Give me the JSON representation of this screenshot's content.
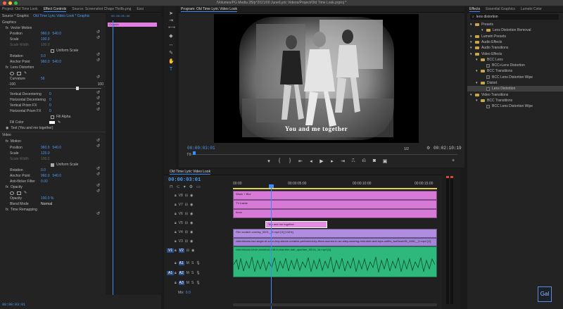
{
  "window": {
    "title": "/Volumes/PG Media 2B/p*2021/00 June/Lyric Videos/Project/Old Time Look.prproj *"
  },
  "effect_controls": {
    "tabs": [
      "Project: Old Time Look",
      "Effect Controls",
      "Source: Screenshot Chaps Thrills.png",
      "Essi"
    ],
    "source": "Source * Graphic",
    "sequence": "Old Time Lyric Video Look * Graphic",
    "timecode_top": "00:00:05:00",
    "clip_label": "Graphic",
    "section_graphics": "Graphics",
    "vector_motion": "Vector Motion",
    "position_label": "Position",
    "position_x": "960.0",
    "position_y": "540.0",
    "scale_label": "Scale",
    "scale_val": "100.0",
    "scale_width_label": "Scale Width",
    "scale_width_val": "100.0",
    "uniform_scale": "Uniform Scale",
    "rotation_label": "Rotation",
    "rotation_val": "0.0",
    "anchor_label": "Anchor Point",
    "anchor_x": "960.0",
    "anchor_y": "540.0",
    "lens_distortion": "Lens Distortion",
    "curvature_label": "Curvature",
    "curvature_val": "56",
    "curv_min": "-100",
    "curv_max": "100",
    "vert_dec": "Vertical Decentering",
    "vert_dec_val": "0",
    "horiz_dec": "Horizontal Decentering",
    "horiz_dec_val": "0",
    "vert_prism": "Vertical Prism FX",
    "vert_prism_val": "0",
    "horiz_prism": "Horizontal Prism FX",
    "horiz_prism_val": "0",
    "fill_alpha": "Fill Alpha",
    "fill_color": "Fill Color",
    "text_layer": "Text (You and me together)",
    "section_video": "Video",
    "motion": "Motion",
    "v_position_x": "960.0",
    "v_position_y": "540.0",
    "v_scale": "125.0",
    "v_scale_width": "100.0",
    "v_rotation": "0.0",
    "v_anchor_x": "960.0",
    "v_anchor_y": "540.0",
    "anti_flicker_label": "Anti-flicker Filter",
    "anti_flicker": "0.00",
    "opacity_section": "Opacity",
    "opacity_label": "Opacity",
    "opacity_val": "100.0 %",
    "blend_label": "Blend Mode",
    "blend_val": "Normal",
    "time_remap": "Time Remapping",
    "timecode_bottom": "00:00:03:01"
  },
  "program": {
    "tab": "Program: Old Time Lyric Video Look",
    "subtitle": "You and me together",
    "timecode": "00:00:03:01",
    "fit": "Fit",
    "resolution": "1/2",
    "duration": "00:02:10:19"
  },
  "timeline": {
    "tab": "Old Time Lyric Video Look",
    "timecode": "00:00:03:01",
    "ruler": [
      "00:00",
      "00:00:05:00",
      "00:00:10:00",
      "00:00:15:00"
    ],
    "tracks": [
      {
        "name": "V8",
        "clip": "Wash + Blur"
      },
      {
        "name": "V7",
        "clip": "TV Inside"
      },
      {
        "name": "V6",
        "clip": "force"
      },
      {
        "name": "V5",
        "clip": ""
      },
      {
        "name": "V4",
        "clip": "You and me together"
      },
      {
        "name": "V3",
        "clip": "Film scratch overlay_0001__0.mp4 [V] [134%]"
      },
      {
        "name": "V2",
        "clip": "videoblocks-two-angle-of-a-fun-hop-dance-creative-performed-by-three-women-in-an-alley-wearing-mini-skirt-and-tops-outfits_lwz5eutx35_1080__D.mp4 [V]"
      },
      {
        "name": "A1",
        "clip": "videoblocks-kevin-macleod-chill-it-chamber-dab_aparfam_f0016_1b.mp4 [A]"
      },
      {
        "name": "A2",
        "clip": ""
      },
      {
        "name": "A3",
        "clip": ""
      }
    ],
    "mix_label": "Mix",
    "mix_val": "0.0",
    "v1_label": "V1",
    "a1_label": "A1"
  },
  "effects": {
    "tabs": [
      "Effects",
      "Essential Graphics",
      "Lumetri Color"
    ],
    "search": "lens distortion",
    "tree": [
      {
        "label": "Presets",
        "indent": 0,
        "kind": "folder"
      },
      {
        "label": "Lens Distortion Removal",
        "indent": 2,
        "kind": "folder"
      },
      {
        "label": "Lumetri Presets",
        "indent": 0,
        "kind": "folder"
      },
      {
        "label": "Audio Effects",
        "indent": 0,
        "kind": "folder"
      },
      {
        "label": "Audio Transitions",
        "indent": 0,
        "kind": "folder"
      },
      {
        "label": "Video Effects",
        "indent": 0,
        "kind": "folder"
      },
      {
        "label": "BCC Lens",
        "indent": 1,
        "kind": "folder"
      },
      {
        "label": "BCC+Lens Distortion",
        "indent": 2,
        "kind": "fx"
      },
      {
        "label": "BCC Transitions",
        "indent": 1,
        "kind": "folder"
      },
      {
        "label": "BCC Lens Distortion Wipe",
        "indent": 2,
        "kind": "fx"
      },
      {
        "label": "Distort",
        "indent": 1,
        "kind": "folder"
      },
      {
        "label": "Lens Distortion",
        "indent": 2,
        "kind": "fx",
        "selected": true
      },
      {
        "label": "Video Transitions",
        "indent": 0,
        "kind": "folder"
      },
      {
        "label": "BCC Transitions",
        "indent": 1,
        "kind": "folder"
      },
      {
        "label": "BCC Lens Distortion Wipe",
        "indent": 2,
        "kind": "fx"
      }
    ]
  },
  "watermark": "Gal"
}
